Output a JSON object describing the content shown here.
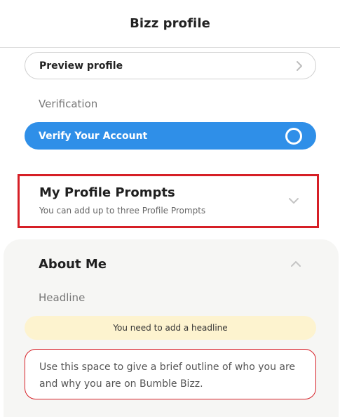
{
  "header": {
    "title": "Bizz profile"
  },
  "preview": {
    "label": "Preview profile"
  },
  "verification": {
    "section_label": "Verification",
    "button_label": "Verify Your Account"
  },
  "prompts": {
    "title": "My Profile Prompts",
    "subtitle": "You can add up to three Profile Prompts"
  },
  "about": {
    "title": "About Me",
    "headline_label": "Headline",
    "warning": "You need to add a headline",
    "placeholder": "Use this space to give a brief outline of who you are and why you are on Bumble Bizz."
  },
  "colors": {
    "accent_blue": "#2f8fe8",
    "error_red": "#d61f26",
    "warning_bg": "#fdf3cf",
    "panel_bg": "#f6f6f4"
  },
  "icons": {
    "preview": "chevron-right-icon",
    "verify": "circle-icon",
    "prompts": "chevron-down-icon",
    "about": "chevron-up-icon"
  }
}
